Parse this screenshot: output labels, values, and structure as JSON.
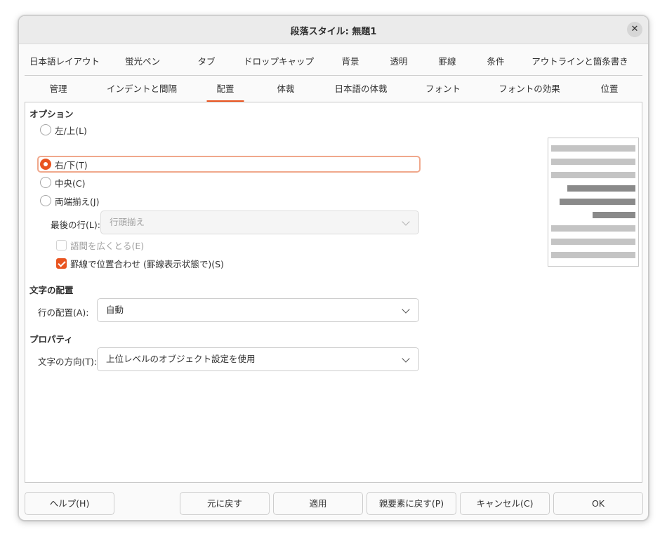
{
  "window": {
    "title": "段落スタイル: 無題1"
  },
  "tabs_top": [
    {
      "label": "日本語レイアウト"
    },
    {
      "label": "蛍光ペン"
    },
    {
      "label": "タブ"
    },
    {
      "label": "ドロップキャップ"
    },
    {
      "label": "背景"
    },
    {
      "label": "透明"
    },
    {
      "label": "罫線"
    },
    {
      "label": "条件"
    },
    {
      "label": "アウトラインと箇条書き"
    }
  ],
  "tabs_bottom": [
    {
      "label": "管理"
    },
    {
      "label": "インデントと間隔"
    },
    {
      "label": "配置",
      "active": true
    },
    {
      "label": "体裁"
    },
    {
      "label": "日本語の体裁"
    },
    {
      "label": "フォント"
    },
    {
      "label": "フォントの効果"
    },
    {
      "label": "位置"
    }
  ],
  "options": {
    "title": "オプション",
    "radios": [
      {
        "label": "左/上(L)",
        "checked": false
      },
      {
        "label": "右/下(T)",
        "checked": true
      },
      {
        "label": "中央(C)",
        "checked": false
      },
      {
        "label": "両端揃え(J)",
        "checked": false
      }
    ],
    "last_line_label": "最後の行(L):",
    "last_line_value": "行頭揃え",
    "expand_word_label": "語間を広くとる(E)",
    "expand_word_checked": false,
    "snap_to_grid_label": "罫線で位置合わせ (罫線表示状態で)(S)",
    "snap_to_grid_checked": true
  },
  "text_alignment": {
    "title": "文字の配置",
    "label": "行の配置(A):",
    "value": "自動"
  },
  "properties": {
    "title": "プロパティ",
    "label": "文字の方向(T):",
    "value": "上位レベルのオブジェクト設定を使用"
  },
  "preview": {
    "colors": {
      "light": "#c4c4c4",
      "dark": "#8a8a8a"
    }
  },
  "buttons": {
    "help": "ヘルプ(H)",
    "reset": "元に戻す",
    "apply": "適用",
    "parent": "親要素に戻す(P)",
    "cancel": "キャンセル(C)",
    "ok": "OK"
  },
  "colors": {
    "accent": "#e95420"
  }
}
